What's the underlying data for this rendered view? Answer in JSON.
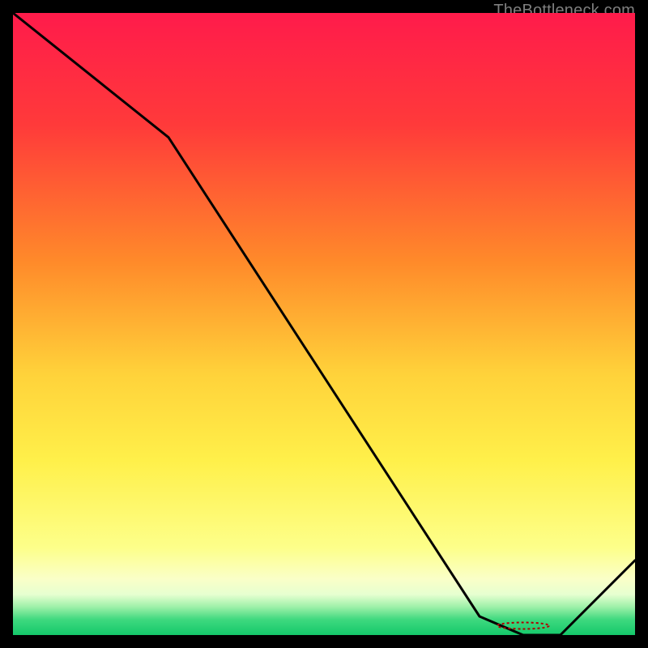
{
  "watermark": "TheBottleneck.com",
  "chart_data": {
    "type": "line",
    "title": "",
    "xlabel": "",
    "ylabel": "",
    "xlim": [
      0,
      100
    ],
    "ylim": [
      0,
      100
    ],
    "x": [
      0,
      5,
      25,
      75,
      82,
      88,
      100
    ],
    "values": [
      100,
      96,
      80,
      3,
      0,
      0,
      12
    ],
    "marker": {
      "x": 82,
      "y": 1.5,
      "label": ""
    },
    "gradient_stops": [
      {
        "pct": 0,
        "color": "#ff1b4b"
      },
      {
        "pct": 18,
        "color": "#ff3a3a"
      },
      {
        "pct": 40,
        "color": "#ff8a2a"
      },
      {
        "pct": 58,
        "color": "#ffd23a"
      },
      {
        "pct": 72,
        "color": "#fff04a"
      },
      {
        "pct": 86,
        "color": "#fdff8a"
      },
      {
        "pct": 91,
        "color": "#faffc8"
      },
      {
        "pct": 93.5,
        "color": "#e6ffd0"
      },
      {
        "pct": 95.5,
        "color": "#9df0a8"
      },
      {
        "pct": 97.5,
        "color": "#3fd97f"
      },
      {
        "pct": 100,
        "color": "#14c86a"
      }
    ]
  }
}
